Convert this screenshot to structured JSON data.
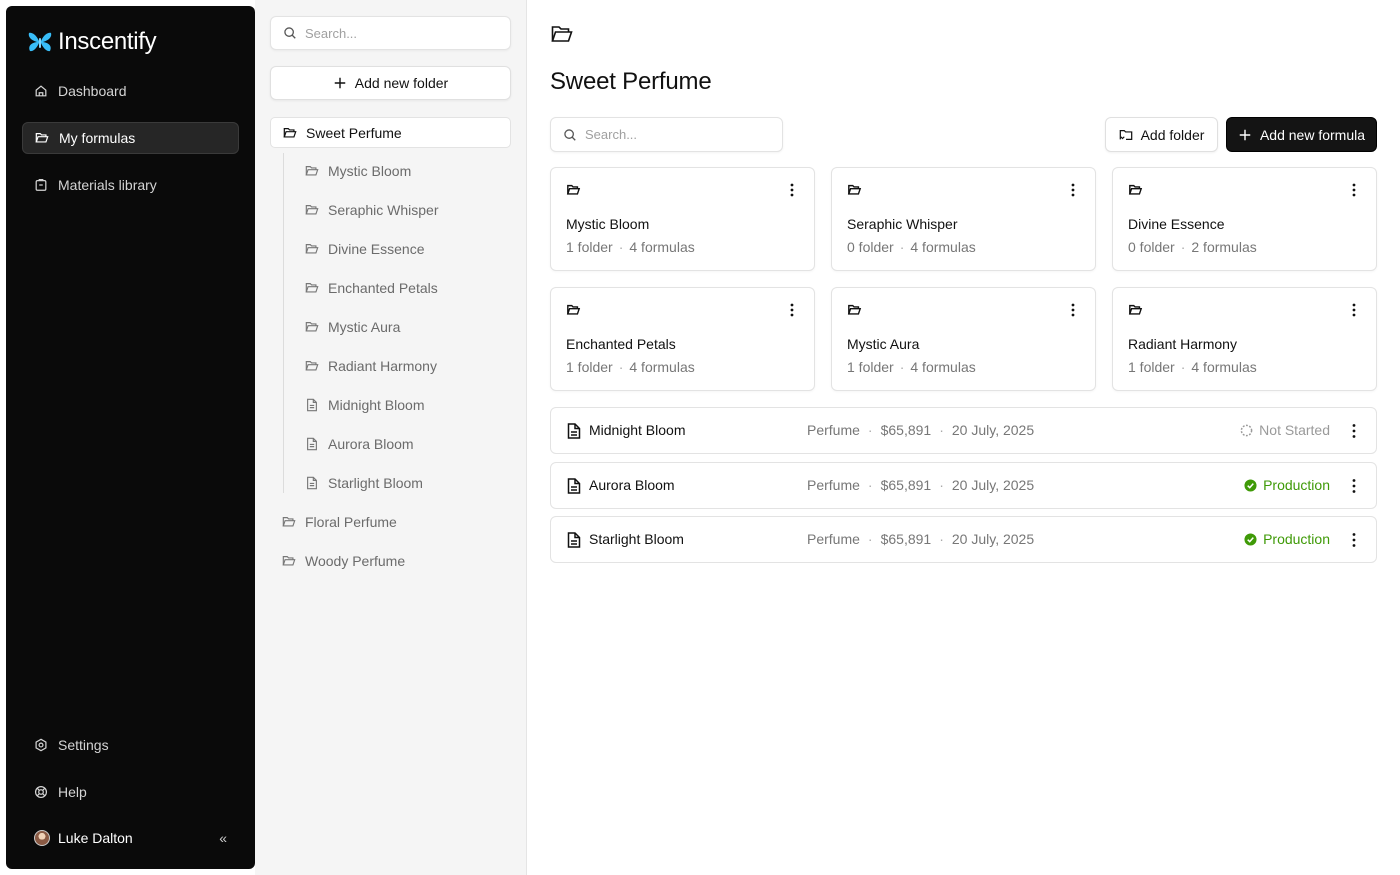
{
  "sidebar": {
    "brand": "Inscentify",
    "nav": [
      {
        "label": "Dashboard",
        "icon": "home-icon"
      },
      {
        "label": "My formulas",
        "icon": "folder-open-icon"
      },
      {
        "label": "Materials library",
        "icon": "clipboard-icon"
      }
    ],
    "bottom": [
      {
        "label": "Settings",
        "icon": "gear-icon"
      },
      {
        "label": "Help",
        "icon": "lifebuoy-icon"
      }
    ],
    "user": {
      "name": "Luke Dalton",
      "collapse": "«"
    }
  },
  "tree": {
    "search_placeholder": "Search...",
    "add_button": "Add new folder",
    "root": "Sweet Perfume",
    "children": [
      {
        "label": "Mystic Bloom",
        "kind": "folder"
      },
      {
        "label": "Seraphic Whisper",
        "kind": "folder"
      },
      {
        "label": "Divine Essence",
        "kind": "folder"
      },
      {
        "label": "Enchanted Petals",
        "kind": "folder"
      },
      {
        "label": "Mystic Aura",
        "kind": "folder"
      },
      {
        "label": "Radiant Harmony",
        "kind": "folder"
      },
      {
        "label": "Midnight Bloom",
        "kind": "file"
      },
      {
        "label": "Aurora Bloom",
        "kind": "file"
      },
      {
        "label": "Starlight Bloom",
        "kind": "file"
      }
    ],
    "siblings": [
      {
        "label": "Floral Perfume"
      },
      {
        "label": "Woody Perfume"
      }
    ]
  },
  "main": {
    "title": "Sweet Perfume",
    "search_placeholder": "Search...",
    "add_folder": "Add folder",
    "add_formula": "Add new formula",
    "folders": [
      {
        "name": "Mystic Bloom",
        "folders": "1 folder",
        "formulas": "4 formulas"
      },
      {
        "name": "Seraphic Whisper",
        "folders": "0 folder",
        "formulas": "4 formulas"
      },
      {
        "name": "Divine Essence",
        "folders": "0 folder",
        "formulas": "2 formulas"
      },
      {
        "name": "Enchanted Petals",
        "folders": "1 folder",
        "formulas": "4 formulas"
      },
      {
        "name": "Mystic Aura",
        "folders": "1 folder",
        "formulas": "4 formulas"
      },
      {
        "name": "Radiant Harmony",
        "folders": "1 folder",
        "formulas": "4 formulas"
      }
    ],
    "formulas": [
      {
        "name": "Midnight Bloom",
        "category": "Perfume",
        "price": "$65,891",
        "date": "20 July, 2025",
        "status": "Not Started"
      },
      {
        "name": "Aurora Bloom",
        "category": "Perfume",
        "price": "$65,891",
        "date": "20 July, 2025",
        "status": "Production"
      },
      {
        "name": "Starlight Bloom",
        "category": "Perfume",
        "price": "$65,891",
        "date": "20 July, 2025",
        "status": "Production"
      }
    ],
    "meta_separator": "·"
  },
  "colors": {
    "sidebar_bg": "#0a0a0a",
    "brand_accent": "#38bdf8",
    "status_production": "#3f9a07",
    "status_not_started": "#9a9a9a"
  }
}
